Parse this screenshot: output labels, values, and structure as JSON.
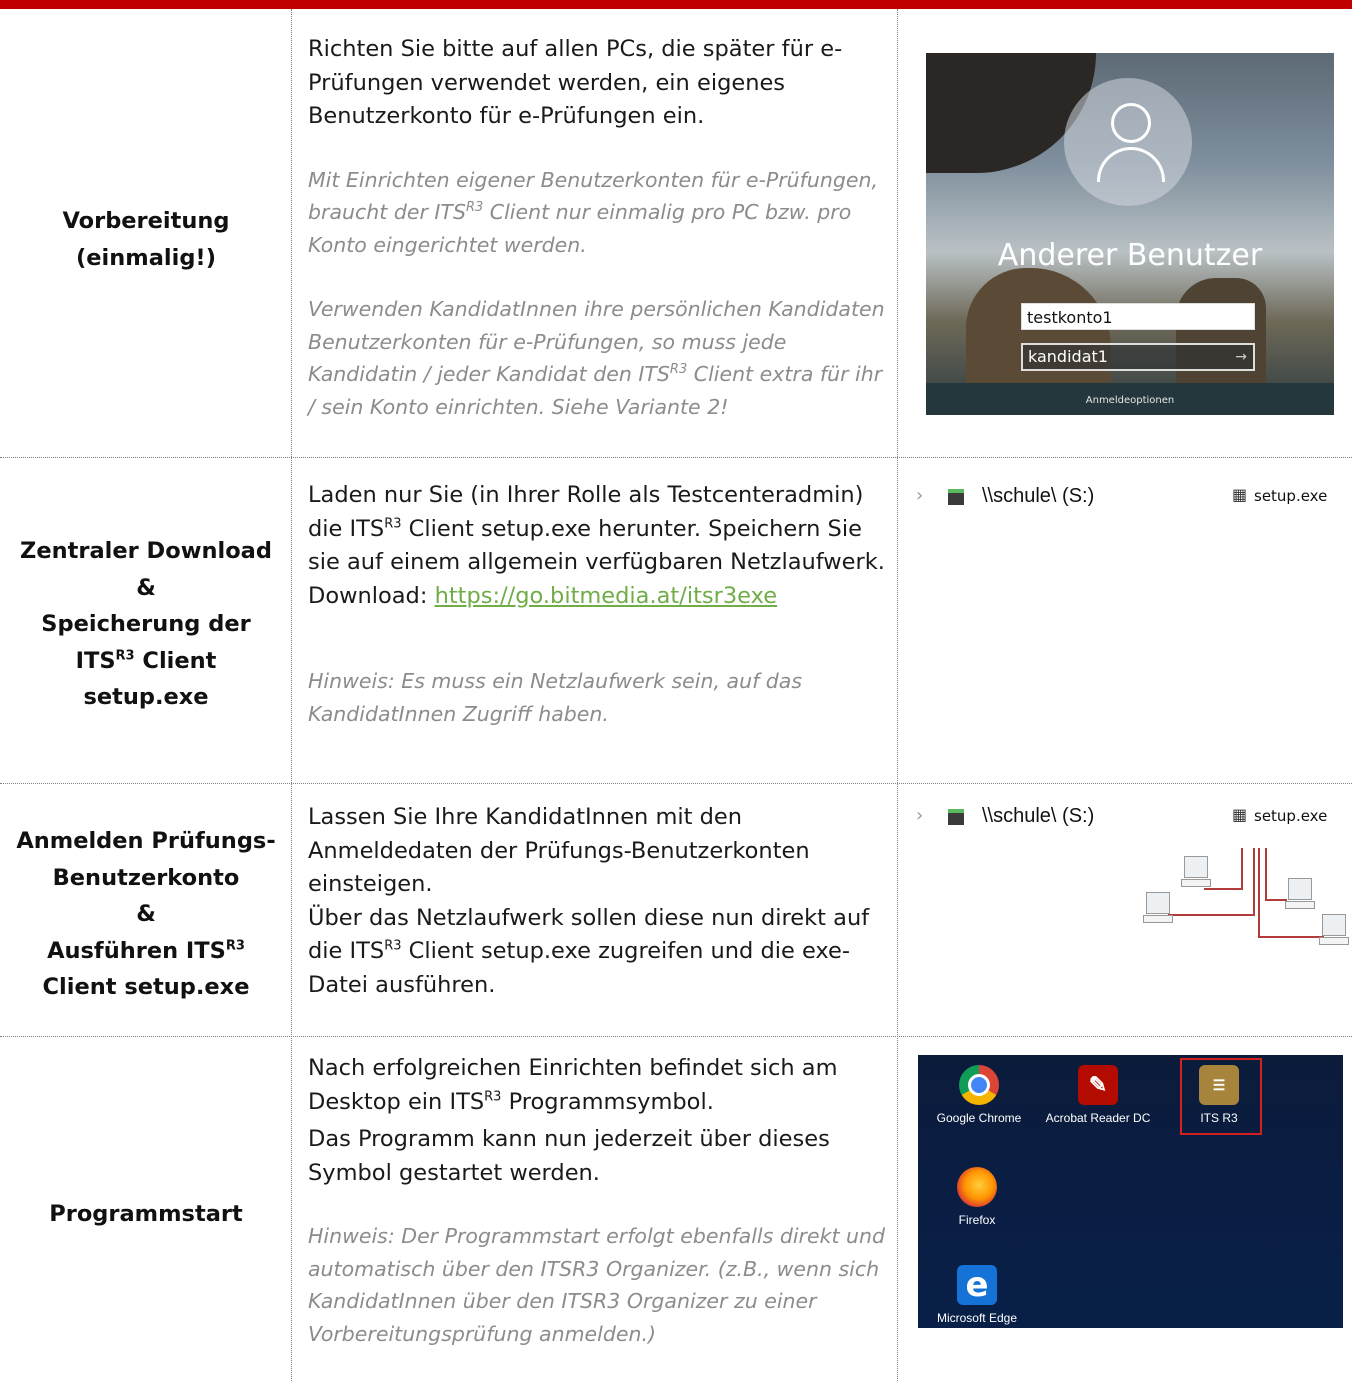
{
  "rows": [
    {
      "label_lines": [
        "Vorbereitung",
        "(einmalig!)"
      ],
      "p1": "Richten Sie bitte auf allen PCs, die später für e-Prüfungen verwendet werden, ein eigenes Benutzerkonto für e-Prüfungen ein.",
      "note1_a": "Mit Einrichten eigener Benutzerkonten für e-Prüfungen, braucht der ITS",
      "note1_sup": "R3",
      "note1_b": " Client nur einmalig pro PC bzw. pro Konto eingerichtet werden.",
      "note2_a": "Verwenden KandidatInnen ihre persönlichen Kandidaten Benutzerkonten für e-Prüfungen, so muss jede Kandidatin / jeder Kandidat den ITS",
      "note2_sup": "R3",
      "note2_b": " Client extra für ihr / sein Konto einrichten. Siehe Variante 2!"
    },
    {
      "label_l1": "Zentraler Download",
      "label_l2": "&",
      "label_l3": "Speicherung der",
      "label_l4a": "ITS",
      "label_l4sup": "R3",
      "label_l4b": " Client",
      "label_l5": "setup.exe",
      "p1_a": "Laden nur Sie (in Ihrer Rolle als Testcenteradmin) die ITS",
      "p1_sup": "R3",
      "p1_b": " Client setup.exe herunter. Speichern Sie sie auf einem allgemein verfügbaren Netzlaufwerk.",
      "download_label": "Download: ",
      "download_link": "https://go.bitmedia.at/itsr3exe",
      "note": "Hinweis: Es muss ein Netzlaufwerk sein, auf das KandidatInnen Zugriff haben."
    },
    {
      "label_l1": "Anmelden Prüfungs-",
      "label_l2": "Benutzerkonto",
      "label_l3": "&",
      "label_l4a": "Ausführen ITS",
      "label_l4sup": "R3",
      "label_l5": "Client setup.exe",
      "p1": "Lassen Sie Ihre KandidatInnen mit den Anmeldedaten der Prüfungs-Benutzerkonten einsteigen.",
      "p2_a": "Über das Netzlaufwerk sollen diese nun direkt auf die ITS",
      "p2_sup": "R3",
      "p2_b": " Client setup.exe zugreifen und die exe-Datei ausführen."
    },
    {
      "label": "Programmstart",
      "p1_a": "Nach erfolgreichen Einrichten befindet sich am Desktop ein ITS",
      "p1_sup": "R3",
      "p1_b": " Programmsymbol.",
      "p2": "Das Programm kann nun jederzeit über dieses Symbol gestartet werden.",
      "note": "Hinweis: Der Programmstart erfolgt ebenfalls direkt und automatisch über den ITSR3 Organizer. (z.B., wenn sich KandidatInnen über den ITSR3 Organizer zu einer Vorbereitungsprüfung anmelden.)"
    }
  ],
  "login_screen": {
    "username_title": "Anderer Benutzer",
    "field1": "testkonto1",
    "field2": "kandidat1",
    "options": "Anmeldeoptionen"
  },
  "explorer": {
    "drive_label": "\\\\schule\\ (S:)",
    "file_name": "setup.exe"
  },
  "desktop_icons": {
    "chrome": "Google Chrome",
    "acrobat": "Acrobat Reader DC",
    "its": "ITS R3",
    "firefox": "Firefox",
    "edge": "Microsoft Edge"
  },
  "colors": {
    "top_bar": "#c00000",
    "link": "#70ad47",
    "note": "#8c8c8c"
  }
}
